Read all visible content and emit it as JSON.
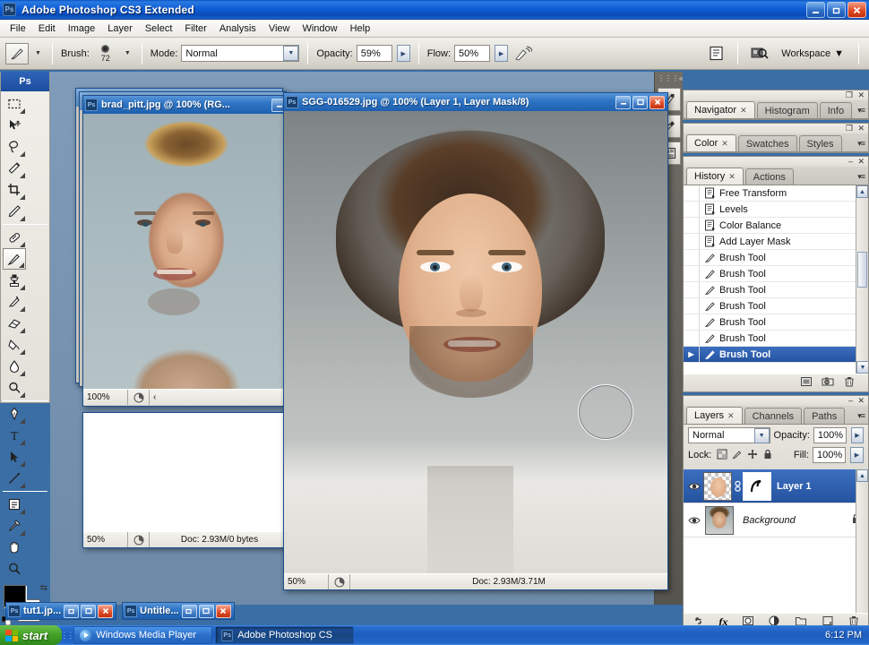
{
  "window": {
    "title": "Adobe Photoshop CS3 Extended",
    "app_icon": "photoshop-icon",
    "minimize": "–",
    "restore": "❐",
    "close": "✕"
  },
  "menubar": {
    "items": [
      "File",
      "Edit",
      "Image",
      "Layer",
      "Select",
      "Filter",
      "Analysis",
      "View",
      "Window",
      "Help"
    ]
  },
  "options_bar": {
    "tool_icon": "brush-tool-icon",
    "brush_label": "Brush:",
    "brush_size": "72",
    "mode_label": "Mode:",
    "mode_value": "Normal",
    "opacity_label": "Opacity:",
    "opacity_value": "59%",
    "flow_label": "Flow:",
    "flow_value": "50%",
    "airbrush_icon": "airbrush-icon",
    "palettes_icon": "palettes-icon",
    "bridge_icon": "bridge-icon",
    "workspace_label": "Workspace",
    "workspace_caret": "▼"
  },
  "toolbox": {
    "header": "Ps",
    "tools": [
      {
        "name": "rectangular-marquee-tool",
        "glyph": "marquee",
        "has_flyout": true
      },
      {
        "name": "move-tool",
        "glyph": "move",
        "has_flyout": false
      },
      {
        "name": "lasso-tool",
        "glyph": "lasso",
        "has_flyout": true
      },
      {
        "name": "magic-wand-tool",
        "glyph": "wand",
        "has_flyout": false
      },
      {
        "name": "crop-tool",
        "glyph": "crop",
        "has_flyout": false
      },
      {
        "name": "slice-tool",
        "glyph": "slice",
        "has_flyout": true
      },
      {
        "name": "healing-brush-tool",
        "glyph": "heal",
        "has_flyout": true
      },
      {
        "name": "brush-tool",
        "glyph": "brush",
        "has_flyout": true,
        "active": true
      },
      {
        "name": "clone-stamp-tool",
        "glyph": "stamp",
        "has_flyout": true
      },
      {
        "name": "history-brush-tool",
        "glyph": "historybrush",
        "has_flyout": true
      },
      {
        "name": "eraser-tool",
        "glyph": "eraser",
        "has_flyout": true
      },
      {
        "name": "gradient-tool",
        "glyph": "paintbucket",
        "has_flyout": true
      },
      {
        "name": "blur-tool",
        "glyph": "blur",
        "has_flyout": true
      },
      {
        "name": "dodge-tool",
        "glyph": "dodge",
        "has_flyout": true
      },
      {
        "name": "pen-tool",
        "glyph": "pen",
        "has_flyout": true
      },
      {
        "name": "type-tool",
        "glyph": "type",
        "has_flyout": true
      },
      {
        "name": "path-selection-tool",
        "glyph": "pathselect",
        "has_flyout": true
      },
      {
        "name": "line-tool",
        "glyph": "line",
        "has_flyout": true
      },
      {
        "name": "notes-tool",
        "glyph": "notes",
        "has_flyout": true
      },
      {
        "name": "eyedropper-tool",
        "glyph": "eyedropper",
        "has_flyout": true
      },
      {
        "name": "hand-tool",
        "glyph": "hand",
        "has_flyout": false
      },
      {
        "name": "zoom-tool",
        "glyph": "zoom",
        "has_flyout": false
      }
    ],
    "foreground_color": "#000000",
    "background_color": "#ffffff",
    "swap_icon": "swap-colors-icon",
    "default_icon": "default-colors-icon"
  },
  "documents": [
    {
      "name": "brad_pitt.jpg @ 100% (RG...",
      "zoom": "100%",
      "doc_info": "",
      "active": false
    },
    {
      "name": "brad_pitt.jpg",
      "zoom": "50%",
      "doc_info": "Doc: 2.93M/0 bytes",
      "active": false
    },
    {
      "name": "SGG-016529.jpg @ 100% (Layer 1, Layer Mask/8)",
      "zoom": "50%",
      "doc_info": "Doc: 2.93M/3.71M",
      "active": true
    }
  ],
  "minimized_docs": [
    {
      "name": "tut1.jp...",
      "restore": "❐",
      "maximize": "□",
      "close": "✕"
    },
    {
      "name": "Untitle...",
      "restore": "❐",
      "maximize": "□",
      "close": "✕"
    }
  ],
  "dock_strip": {
    "collapse_icon": "double-chevron-left-icon",
    "buttons": [
      {
        "name": "brushes-panel-icon"
      },
      {
        "name": "tool-presets-panel-icon"
      },
      {
        "name": "layer-comps-panel-icon"
      }
    ]
  },
  "panels": {
    "navigator_group": {
      "tabs": [
        "Navigator",
        "Histogram",
        "Info"
      ],
      "active_tab": "Navigator",
      "menu_icon": "panel-menu-icon",
      "minimize": "❐",
      "close": "✕"
    },
    "color_group": {
      "tabs": [
        "Color",
        "Swatches",
        "Styles"
      ],
      "active_tab": "Color",
      "menu_icon": "panel-menu-icon",
      "minimize": "❐",
      "close": "✕"
    },
    "history_group": {
      "tabs": [
        "History",
        "Actions"
      ],
      "active_tab": "History",
      "menu_icon": "panel-menu-icon",
      "minimize": "–",
      "close": "✕",
      "items": [
        {
          "label": "Free Transform",
          "icon": "history-state-icon",
          "selected": false
        },
        {
          "label": "Levels",
          "icon": "history-state-icon",
          "selected": false
        },
        {
          "label": "Color Balance",
          "icon": "history-state-icon",
          "selected": false
        },
        {
          "label": "Add Layer Mask",
          "icon": "history-state-icon",
          "selected": false
        },
        {
          "label": "Brush Tool",
          "icon": "brush-tool-icon",
          "selected": false
        },
        {
          "label": "Brush Tool",
          "icon": "brush-tool-icon",
          "selected": false
        },
        {
          "label": "Brush Tool",
          "icon": "brush-tool-icon",
          "selected": false
        },
        {
          "label": "Brush Tool",
          "icon": "brush-tool-icon",
          "selected": false
        },
        {
          "label": "Brush Tool",
          "icon": "brush-tool-icon",
          "selected": false
        },
        {
          "label": "Brush Tool",
          "icon": "brush-tool-icon",
          "selected": false
        },
        {
          "label": "Brush Tool",
          "icon": "brush-tool-icon",
          "selected": true
        }
      ],
      "footer_buttons": [
        {
          "name": "new-document-from-state-button",
          "glyph": "doc"
        },
        {
          "name": "create-new-snapshot-button",
          "glyph": "camera"
        },
        {
          "name": "delete-state-button",
          "glyph": "trash"
        }
      ]
    },
    "layers_group": {
      "tabs": [
        "Layers",
        "Channels",
        "Paths"
      ],
      "active_tab": "Layers",
      "menu_icon": "panel-menu-icon",
      "minimize": "–",
      "close": "✕",
      "blend_mode": "Normal",
      "opacity_label": "Opacity:",
      "opacity_value": "100%",
      "lock_label": "Lock:",
      "lock_icons": [
        "lock-transparency-icon",
        "lock-image-icon",
        "lock-position-icon",
        "lock-all-icon"
      ],
      "fill_label": "Fill:",
      "fill_value": "100%",
      "layers": [
        {
          "name": "Layer 1",
          "visible": true,
          "selected": true,
          "has_mask": true,
          "linked": true,
          "locked": false
        },
        {
          "name": "Background",
          "visible": true,
          "selected": false,
          "has_mask": false,
          "linked": false,
          "locked": true
        }
      ],
      "footer_buttons": [
        {
          "name": "link-layers-button",
          "glyph": "link"
        },
        {
          "name": "add-layer-style-button",
          "glyph": "fx"
        },
        {
          "name": "add-layer-mask-button",
          "glyph": "mask"
        },
        {
          "name": "new-adjustment-layer-button",
          "glyph": "adjust"
        },
        {
          "name": "new-group-button",
          "glyph": "folder"
        },
        {
          "name": "new-layer-button",
          "glyph": "newlayer"
        },
        {
          "name": "delete-layer-button",
          "glyph": "trash"
        }
      ]
    }
  },
  "taskbar": {
    "start_label": "start",
    "items": [
      {
        "label": "Windows Media Player",
        "icon": "media-player-icon",
        "active": false
      },
      {
        "label": "Adobe Photoshop CS",
        "icon": "photoshop-icon",
        "active": true
      }
    ],
    "clock": "6:12 PM"
  },
  "colors": {
    "title_blue": "#1e5fae",
    "panel_gray": "#e9e7e0",
    "selection_blue": "#24539f",
    "start_green": "#44a42a"
  }
}
